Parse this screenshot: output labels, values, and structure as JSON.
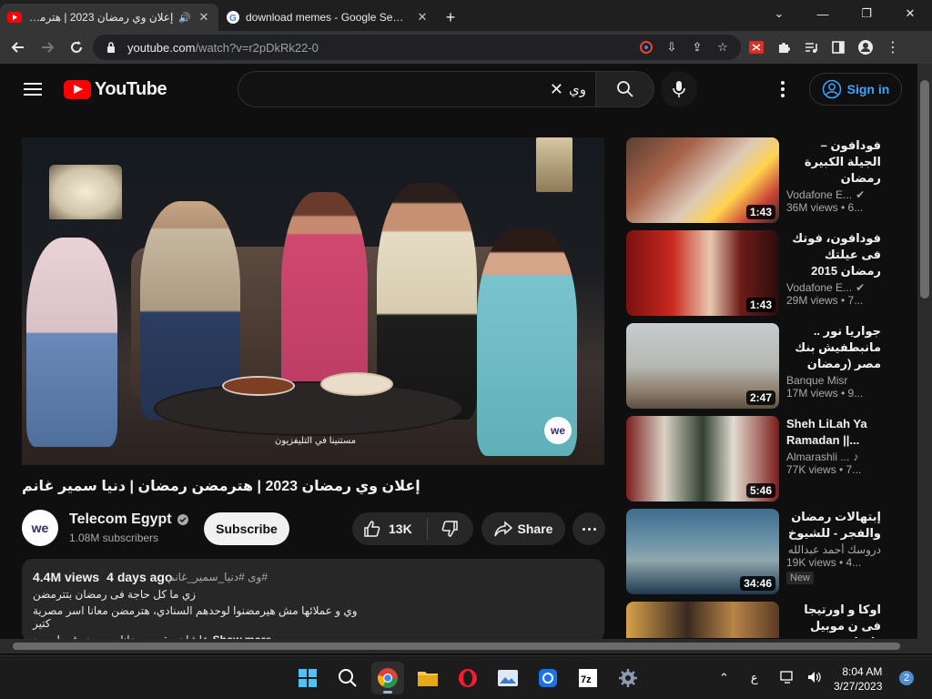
{
  "browser": {
    "tabs": [
      {
        "title": "إعلان وي رمضان 2023 | هترمضن",
        "active": true
      },
      {
        "title": "download memes - Google Search",
        "active": false
      }
    ],
    "url_host": "youtube.com",
    "url_path": "/watch?v=r2pDkRk22-0"
  },
  "yt": {
    "logo_text": "YouTube",
    "search_value": "وي",
    "signin_label": "Sign in",
    "video_title": "إعلان وي رمضان 2023 | هترمضن رمضان | دنيا سمير غانم",
    "overlay_caption": "مستنينا في التليفزيون",
    "overlay_logo": "we",
    "channel": {
      "avatar_text": "we",
      "name": "Telecom Egypt",
      "subs": "1.08M subscribers"
    },
    "subscribe_label": "Subscribe",
    "likes": "13K",
    "share_label": "Share",
    "description": {
      "views": "4.4M views",
      "age": "4 days ago",
      "hashtags": "#وى #دنيا_سمير_غانم",
      "line1": "زي ما كل حاجة فى رمضان بتترمضن",
      "line2": "وي و عملائها مش هيرمضنوا لوحدهم السنادي، هترمضن معانا اسر مصرية كتير",
      "line3": "علشان يبقي رمضانا مع بعض غير اى حد",
      "show_more": "Show more"
    },
    "sidebar": [
      {
        "title": "فودافون – الجيلة الكبيرة رمضان",
        "channel": "Vodafone E...",
        "views": "36M views • 6...",
        "duration": "1:43",
        "verified": true
      },
      {
        "title": "فودافون، فوتك فى عيلتك رمضان 2015",
        "channel": "Vodafone E...",
        "views": "29M views • 7...",
        "duration": "1:43",
        "verified": true
      },
      {
        "title": "جواريا نور .. مانبطفيش بنك مصر (رمضان",
        "channel": "Banque Misr",
        "views": "17M views • 9...",
        "duration": "2:47",
        "verified": false
      },
      {
        "title": "Sheh LiLah Ya Ramadan ||...",
        "channel": "Almarashli ...",
        "views": "77K views • 7...",
        "duration": "5:46",
        "verified": false,
        "music": true
      },
      {
        "title": "إبتهالات رمضان والفجر - للشيوخ",
        "channel": "دروسك أحمد عبدالله",
        "views": "19K views • 4...",
        "duration": "34:46",
        "badge": "New"
      },
      {
        "title": "اوكا و اورتيجا فى ن موبيل دايما مع",
        "channel": "",
        "views": "",
        "duration": ""
      }
    ]
  },
  "taskbar": {
    "time": "8:04 AM",
    "date": "3/27/2023",
    "lang": "ع",
    "notifications": "2"
  },
  "colors": {
    "accent_link": "#3ea6ff",
    "yt_red": "#ff0000",
    "bg": "#0f0f0f"
  }
}
